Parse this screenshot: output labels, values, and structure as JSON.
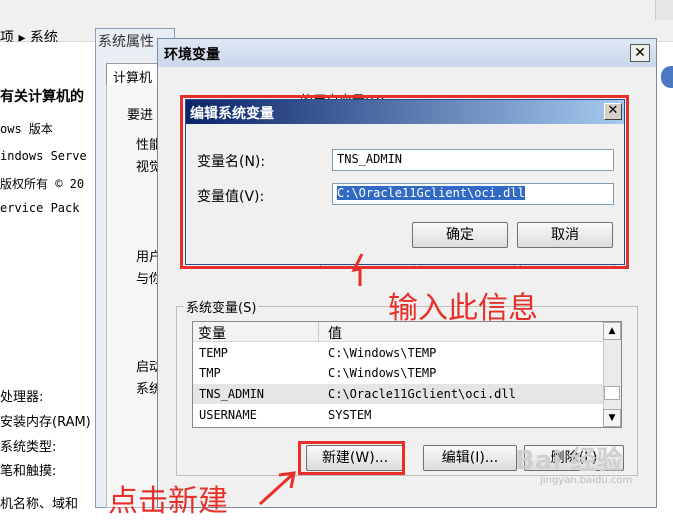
{
  "background": {
    "breadcrumb": "项 ▸ 系统",
    "about_title": "有关计算机的",
    "left_lines": [
      "ows 版本",
      "indows Serve",
      "版权所有 © 20",
      "ervice Pack"
    ],
    "bottom_lines": [
      "处理器:",
      "安装内存(RAM)",
      "系统类型:",
      "笔和触摸:",
      "机名称、域和"
    ]
  },
  "system_properties": {
    "title": "系统属性",
    "tab": "计算机",
    "line_advanced": "要进",
    "group_perf": "性能",
    "perf_sub": "视觉",
    "group_user": "用户",
    "user_sub": "与你",
    "group_start": "启动",
    "start_sub": "系统"
  },
  "env_window": {
    "title": "环境变量",
    "close": "✕",
    "user_vars_label": "的用户变量(U)",
    "system_vars_label": "系统变量(S)",
    "columns": [
      "变量",
      "值"
    ],
    "rows": [
      {
        "name": "TEMP",
        "value": "C:\\Windows\\TEMP"
      },
      {
        "name": "TMP",
        "value": "C:\\Windows\\TEMP"
      },
      {
        "name": "TNS_ADMIN",
        "value": "C:\\Oracle11Gclient\\oci.dll"
      },
      {
        "name": "USERNAME",
        "value": "SYSTEM"
      }
    ],
    "btn_new": "新建(W)...",
    "btn_edit": "编辑(I)...",
    "btn_delete": "删除(L)"
  },
  "edit_dialog": {
    "title": "编辑系统变量",
    "close": "✕",
    "name_label": "变量名(N):",
    "value_label": "变量值(V):",
    "name_value": "TNS_ADMIN",
    "value_value": "C:\\Oracle11Gclient\\oci.dll",
    "ok": "确定",
    "cancel": "取消"
  },
  "annotations": {
    "enter_info": "输入此信息",
    "click_new": "点击新建"
  },
  "watermark": "Bai 经验",
  "watermark_url": "jingyan.baidu.com",
  "colors": {
    "annotation": "#e8302a",
    "title_active": "#0a246a",
    "selection": "#316ac5"
  }
}
